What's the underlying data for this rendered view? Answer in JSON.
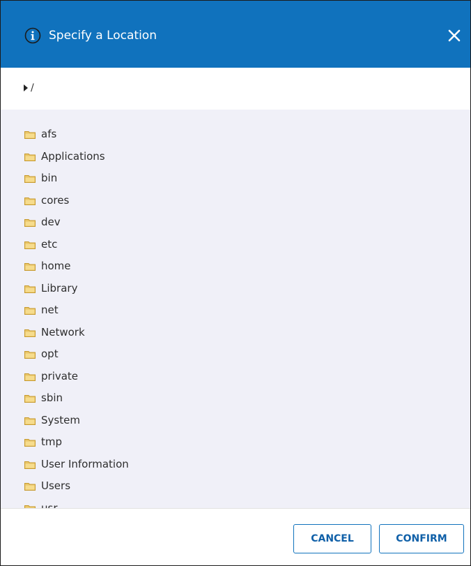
{
  "dialog": {
    "title": "Specify a Location",
    "header_color": "#1072bd",
    "icons": {
      "info": "info-circle-icon",
      "close": "close-icon",
      "path_expand": "triangle-right-icon",
      "folder": "folder-icon"
    }
  },
  "pathbar": {
    "path": "/"
  },
  "tree": {
    "items": [
      {
        "label": "afs"
      },
      {
        "label": "Applications"
      },
      {
        "label": "bin"
      },
      {
        "label": "cores"
      },
      {
        "label": "dev"
      },
      {
        "label": "etc"
      },
      {
        "label": "home"
      },
      {
        "label": "Library"
      },
      {
        "label": "net"
      },
      {
        "label": "Network"
      },
      {
        "label": "opt"
      },
      {
        "label": "private"
      },
      {
        "label": "sbin"
      },
      {
        "label": "System"
      },
      {
        "label": "tmp"
      },
      {
        "label": "User Information"
      },
      {
        "label": "Users"
      },
      {
        "label": "usr"
      }
    ]
  },
  "footer": {
    "cancel_label": "CANCEL",
    "confirm_label": "CONFIRM"
  }
}
